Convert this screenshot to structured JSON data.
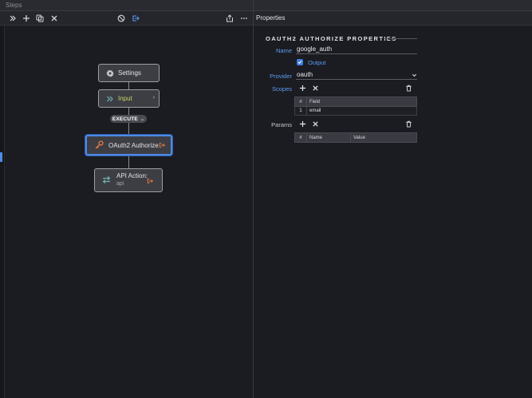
{
  "steps_panel": {
    "title": "Steps",
    "toolbar": {
      "expand_icon": "double-chevron-right-icon",
      "add_icon": "plus-icon",
      "duplicate_icon": "duplicate-icon",
      "delete_icon": "close-icon",
      "disable_icon": "prohibit-icon",
      "goto_icon": "arrow-right-box-icon",
      "share_icon": "share-icon",
      "more_icon": "ellipsis-icon"
    },
    "nodes": {
      "settings": {
        "label": "Settings",
        "icon": "gear-icon"
      },
      "input": {
        "label": "Input",
        "icon": "double-chevron-right-icon"
      },
      "execute": {
        "label": "EXECUTE"
      },
      "oauth": {
        "label": "OAuth2 Authorize",
        "icon": "key-icon",
        "badge_icon": "exit-icon"
      },
      "api": {
        "label": "API Action:",
        "sublabel": "api",
        "icon": "swap-arrows-icon",
        "badge_icon": "exit-icon"
      }
    }
  },
  "properties_panel": {
    "title": "Properties",
    "section_title": "OAUTH2 AUTHORIZE PROPERTIES",
    "name_label": "Name",
    "name_value": "google_auth",
    "output_label": "Output",
    "output_checked": true,
    "provider_label": "Provider",
    "provider_value": "oauth",
    "scopes_label": "Scopes",
    "scopes_table": {
      "headers": [
        "#",
        "Field"
      ],
      "rows": [
        [
          "1",
          "email"
        ]
      ]
    },
    "params_label": "Params",
    "params_table": {
      "headers": [
        "#",
        "Name",
        "Value"
      ]
    }
  },
  "colors": {
    "accent_blue": "#5b9cf0",
    "selected_border": "#4f8ae8",
    "input_label": "#c9d26a",
    "orange_icon": "#e47a45",
    "teal_icon": "#6fb3b0"
  }
}
